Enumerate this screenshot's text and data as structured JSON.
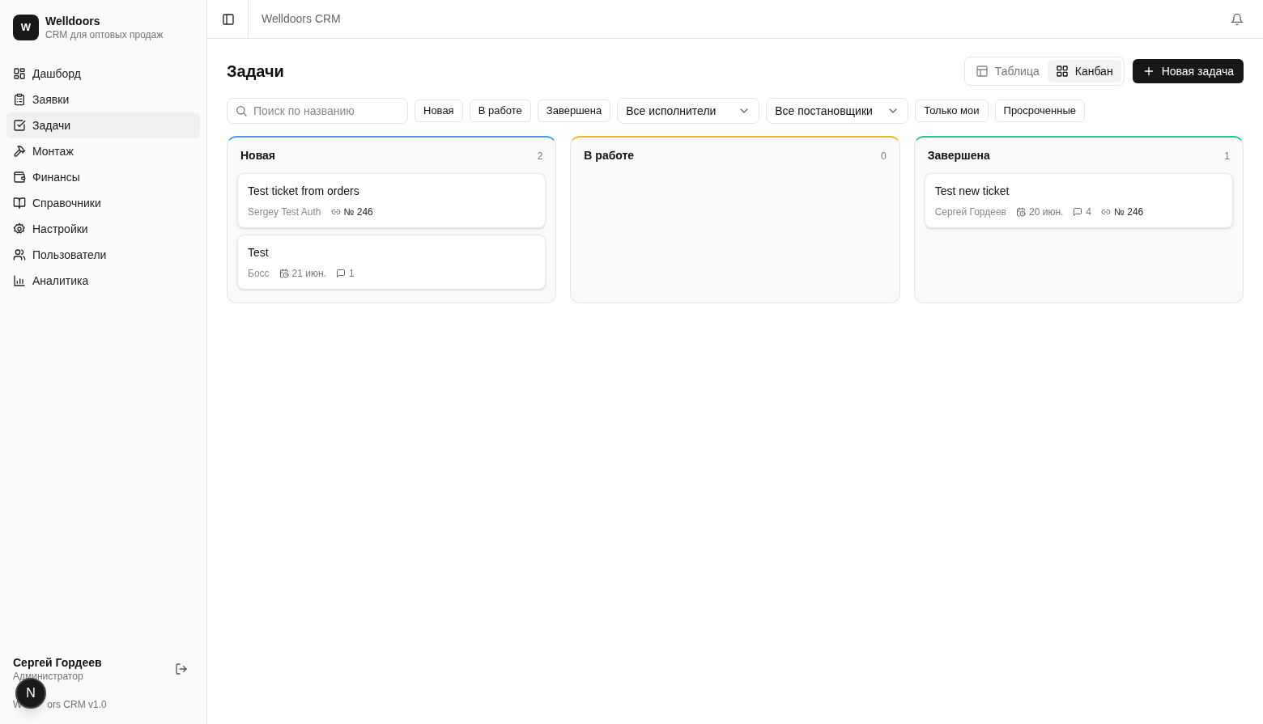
{
  "brand": {
    "logo_letter": "W",
    "name": "Welldoors",
    "subtitle": "CRM для оптовых продаж"
  },
  "nav": [
    {
      "label": "Дашборд",
      "selected": false
    },
    {
      "label": "Заявки",
      "selected": false
    },
    {
      "label": "Задачи",
      "selected": true
    },
    {
      "label": "Монтаж",
      "selected": false
    },
    {
      "label": "Финансы",
      "selected": false
    },
    {
      "label": "Справочники",
      "selected": false
    },
    {
      "label": "Настройки",
      "selected": false
    },
    {
      "label": "Пользователи",
      "selected": false
    },
    {
      "label": "Аналитика",
      "selected": false
    }
  ],
  "user": {
    "name": "Сергей Гордеев",
    "role": "Администратор",
    "version_parts": [
      "W",
      "ors CRM v1.0"
    ]
  },
  "dev_badge": {
    "letter": "N"
  },
  "header": {
    "breadcrumb": "Welldoors CRM"
  },
  "page": {
    "title": "Задачи",
    "view_tabs": [
      {
        "label": "Таблица",
        "selected": false
      },
      {
        "label": "Канбан",
        "selected": true
      }
    ],
    "new_button": "Новая задача"
  },
  "filters": {
    "search_placeholder": "Поиск по названию",
    "items": [
      {
        "kind": "chip",
        "label": "Новая"
      },
      {
        "kind": "chip",
        "label": "В работе"
      },
      {
        "kind": "chip",
        "label": "Завершена"
      },
      {
        "kind": "select",
        "label": "Все исполнители"
      },
      {
        "kind": "select",
        "label": "Все постановщики"
      },
      {
        "kind": "chip",
        "label": "Только мои"
      },
      {
        "kind": "chip",
        "label": "Просроченные"
      }
    ]
  },
  "columns": [
    {
      "title": "Новая",
      "count": "2",
      "color": "#4a9af5",
      "cards": [
        {
          "title": "Test ticket from orders",
          "meta": [
            {
              "kind": "author",
              "text": "Sergey Test Auth"
            },
            {
              "kind": "link",
              "text": "№ 246"
            }
          ]
        },
        {
          "title": "Test",
          "meta": [
            {
              "kind": "author",
              "text": "Босс"
            },
            {
              "kind": "date",
              "text": "21 июн."
            },
            {
              "kind": "comments",
              "text": "1"
            }
          ]
        }
      ]
    },
    {
      "title": "В работе",
      "count": "0",
      "color": "#f0b81c"
    },
    {
      "title": "Завершена",
      "count": "1",
      "color": "#22c596",
      "cards": [
        {
          "title": "Test new ticket",
          "meta": [
            {
              "kind": "author",
              "text": "Сергей Гордеев"
            },
            {
              "kind": "date",
              "text": "20 июн."
            },
            {
              "kind": "comments",
              "text": "4"
            },
            {
              "kind": "link",
              "text": "№ 246"
            }
          ]
        }
      ]
    }
  ]
}
